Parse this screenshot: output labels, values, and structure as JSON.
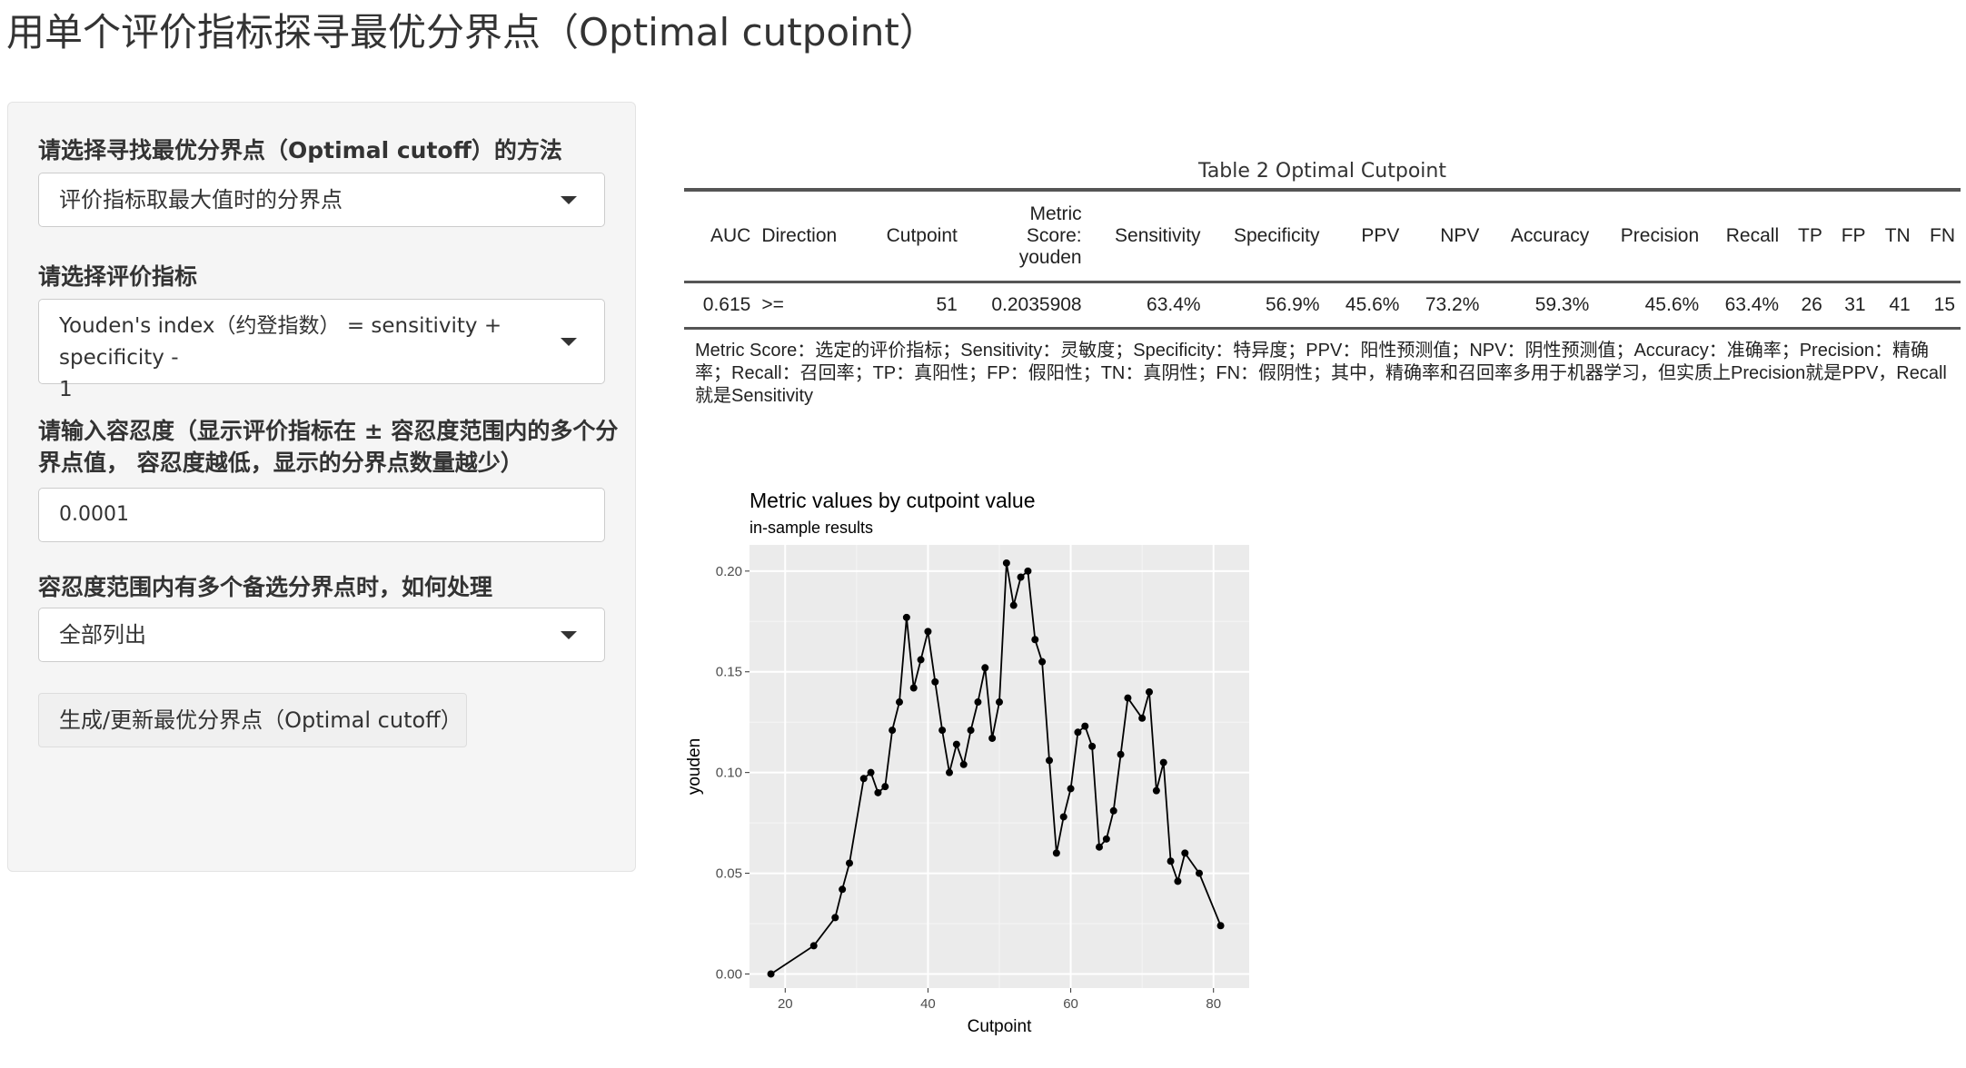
{
  "page": {
    "title": "用单个评价指标探寻最优分界点（Optimal cutpoint）"
  },
  "sidebar": {
    "method_label": "请选择寻找最优分界点（Optimal cutoff）的方法",
    "method_value": "评价指标取最大值时的分界点",
    "metric_label": "请选择评价指标",
    "metric_value_line1": "Youden's index（约登指数） = sensitivity + specificity -",
    "metric_value_line2": "1",
    "tolerance_label_line1": "请输入容忍度（显示评价指标在 ± 容忍度范围内的多个分",
    "tolerance_label_line2": "界点值， 容忍度越低，显示的分界点数量越少）",
    "tolerance_value": "0.0001",
    "multiple_label": "容忍度范围内有多个备选分界点时，如何处理",
    "multiple_value": "全部列出",
    "generate_button": "生成/更新最优分界点（Optimal cutoff）"
  },
  "table": {
    "caption": "Table 2 Optimal Cutpoint",
    "headers": {
      "auc": "AUC",
      "direction": "Direction",
      "cutpoint": "Cutpoint",
      "metric_l1": "Metric",
      "metric_l2": "Score:",
      "metric_l3": "youden",
      "sensitivity": "Sensitivity",
      "specificity": "Specificity",
      "ppv": "PPV",
      "npv": "NPV",
      "accuracy": "Accuracy",
      "precision": "Precision",
      "recall": "Recall",
      "tp": "TP",
      "fp": "FP",
      "tn": "TN",
      "fn": "FN"
    },
    "row": {
      "auc": "0.615",
      "direction": ">=",
      "cutpoint": "51",
      "metric": "0.2035908",
      "sensitivity": "63.4%",
      "specificity": "56.9%",
      "ppv": "45.6%",
      "npv": "73.2%",
      "accuracy": "59.3%",
      "precision": "45.6%",
      "recall": "63.4%",
      "tp": "26",
      "fp": "31",
      "tn": "41",
      "fn": "15"
    },
    "footnote": "Metric Score：选定的评价指标；Sensitivity：灵敏度；Specificity：特异度；PPV：阳性预测值；NPV：阴性预测值；Accuracy：准确率；Precision：精确率；Recall：召回率；TP：真阳性；FP：假阳性；TN：真阴性；FN：假阴性；其中，精确率和召回率多用于机器学习，但实质上Precision就是PPV，Recall就是Sensitivity"
  },
  "chart_data": {
    "type": "line",
    "title": "Metric values by cutpoint value",
    "subtitle": "in-sample results",
    "xlabel": "Cutpoint",
    "ylabel": "youden",
    "xlim": [
      15,
      85
    ],
    "ylim": [
      -0.007,
      0.213
    ],
    "x_ticks": [
      20,
      40,
      60,
      80
    ],
    "y_ticks": [
      0.0,
      0.05,
      0.1,
      0.15,
      0.2
    ],
    "x_tick_labels": [
      "20",
      "40",
      "60",
      "80"
    ],
    "y_tick_labels": [
      "0.00",
      "0.05",
      "0.10",
      "0.15",
      "0.20"
    ],
    "grid": true,
    "panel_color": "#ebebeb",
    "line_color": "#000000",
    "x": [
      18,
      24,
      27,
      28,
      29,
      31,
      32,
      33,
      34,
      35,
      36,
      37,
      38,
      39,
      40,
      41,
      42,
      43,
      44,
      45,
      46,
      47,
      48,
      49,
      50,
      51,
      52,
      53,
      54,
      55,
      56,
      57,
      58,
      59,
      60,
      61,
      62,
      63,
      64,
      65,
      66,
      67,
      68,
      70,
      71,
      72,
      73,
      74,
      75,
      76,
      78,
      81
    ],
    "y": [
      0.0,
      0.014,
      0.028,
      0.042,
      0.055,
      0.097,
      0.1,
      0.09,
      0.093,
      0.121,
      0.135,
      0.177,
      0.142,
      0.156,
      0.17,
      0.145,
      0.121,
      0.1,
      0.114,
      0.104,
      0.121,
      0.135,
      0.152,
      0.117,
      0.135,
      0.204,
      0.183,
      0.197,
      0.2,
      0.166,
      0.155,
      0.106,
      0.06,
      0.078,
      0.092,
      0.12,
      0.123,
      0.113,
      0.063,
      0.067,
      0.081,
      0.109,
      0.137,
      0.127,
      0.14,
      0.091,
      0.105,
      0.056,
      0.046,
      0.06,
      0.05,
      0.024
    ]
  }
}
